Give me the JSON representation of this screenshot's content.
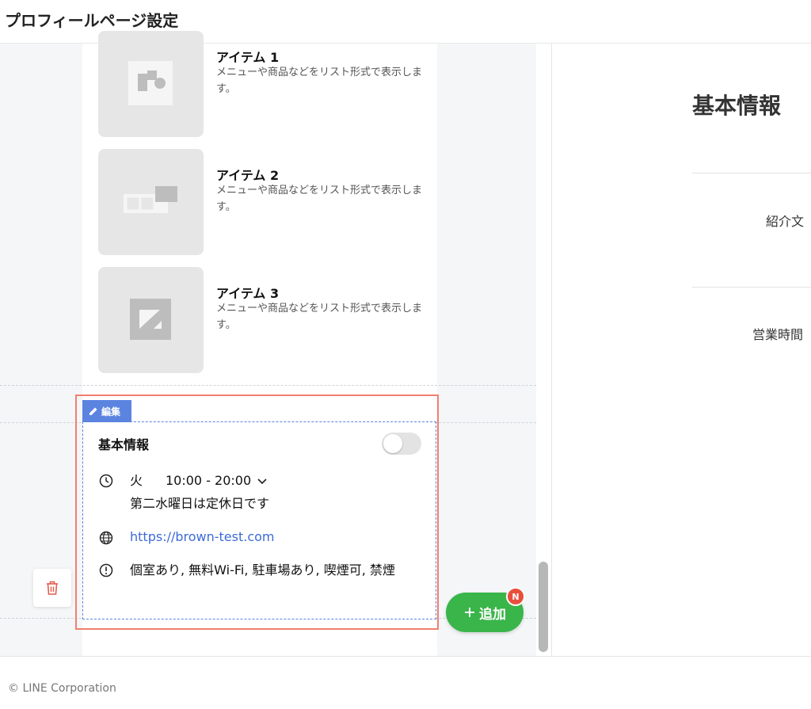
{
  "header": {
    "title": "プロフィールページ設定"
  },
  "items": [
    {
      "name": "アイテム 1",
      "description": "メニューや商品などをリスト形式で表示します。"
    },
    {
      "name": "アイテム 2",
      "description": "メニューや商品などをリスト形式で表示します。"
    },
    {
      "name": "アイテム 3",
      "description": "メニューや商品などをリスト形式で表示します。"
    }
  ],
  "edit_tag": {
    "label": "編集"
  },
  "basic_info_card": {
    "title": "基本情報",
    "toggle_on": false,
    "hours": {
      "day": "火",
      "time": "10:00 - 20:00"
    },
    "holiday_note": "第二水曜日は定休日です",
    "url": "https://brown-test.com",
    "facilities": "個室あり, 無料Wi-Fi, 駐車場あり, 喫煙可, 禁煙"
  },
  "add_button": {
    "label": "追加",
    "badge": "N"
  },
  "right_panel": {
    "title": "基本情報",
    "labels": {
      "intro": "紹介文",
      "hours": "営業時間"
    }
  },
  "footer": {
    "copyright": "© LINE Corporation"
  },
  "colors": {
    "accent_green": "#3ab54a",
    "edit_blue": "#5b84e0",
    "selection_red": "#f07f6e",
    "link_blue": "#3d6bd8"
  }
}
